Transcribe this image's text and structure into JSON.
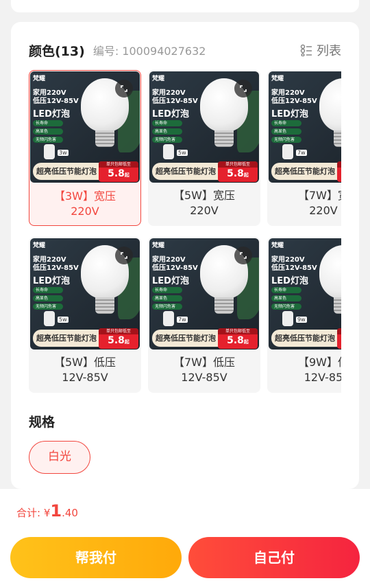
{
  "color_section": {
    "title": "颜色(13)",
    "code_label": "编号: 100094027632",
    "list_label": "列表"
  },
  "products": [
    {
      "label_1": "【3W】宽压",
      "label_2": "220V",
      "watt": "3w",
      "selected": true
    },
    {
      "label_1": "【5W】宽压",
      "label_2": "220V",
      "watt": "5w",
      "selected": false
    },
    {
      "label_1": "【7W】宽",
      "label_2": "220V",
      "watt": "7w",
      "selected": false
    },
    {
      "label_1": "【5W】低压",
      "label_2": "12V-85V",
      "watt": "5w",
      "selected": false
    },
    {
      "label_1": "【7W】低压",
      "label_2": "12V-85V",
      "watt": "7w",
      "selected": false
    },
    {
      "label_1": "【9W】低",
      "label_2": "12V-85",
      "watt": "9w",
      "selected": false
    }
  ],
  "thumb_text": {
    "brand": "梵耀",
    "line1": "家用220V",
    "line2": "低压12V-85V",
    "line3": "LED灯泡",
    "tags": [
      "长寿命",
      "高显色",
      "无频闪危害"
    ],
    "banner": "超亮低压节能灯泡",
    "price_note": "单只包邮低至",
    "price": "5.8",
    "price_suffix": "起"
  },
  "spec_section": {
    "title": "规格",
    "option": "白光"
  },
  "footer": {
    "total_label": "合计: ¥",
    "total_int": "1",
    "total_dec": ".40",
    "help_pay": "帮我付",
    "self_pay": "自己付"
  },
  "colors": {
    "accent": "#f2463e",
    "yellow": "#ffb612"
  }
}
